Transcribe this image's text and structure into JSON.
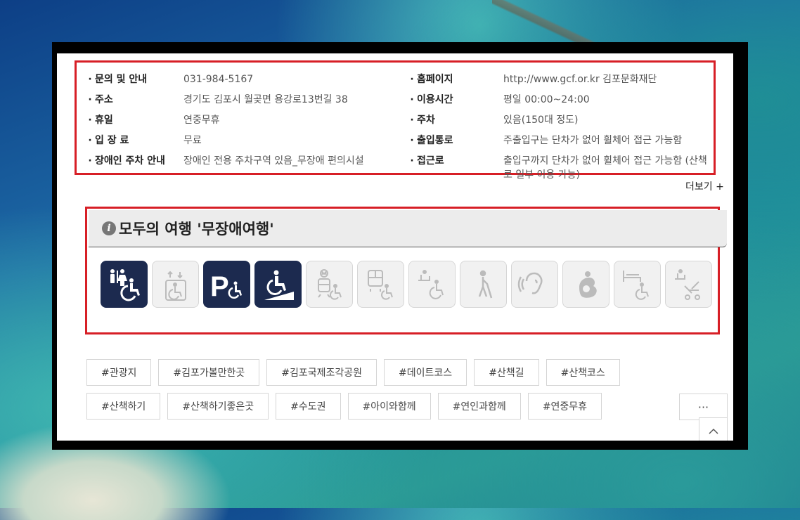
{
  "info": {
    "left": [
      {
        "label": "문의 및 안내",
        "value": "031-984-5167"
      },
      {
        "label": "주소",
        "value": "경기도 김포시 월곶면 용강로13번길 38"
      },
      {
        "label": "휴일",
        "value": "연중무휴"
      },
      {
        "label": "입 장 료",
        "value": "무료"
      },
      {
        "label": "장애인 주차 안내",
        "value": "장애인 전용 주차구역 있음_무장애 편의시설"
      }
    ],
    "right": [
      {
        "label": "홈페이지",
        "value": "http://www.gcf.or.kr 김포문화재단"
      },
      {
        "label": "이용시간",
        "value": "평일 00:00~24:00"
      },
      {
        "label": "주차",
        "value": "있음(150대 정도)"
      },
      {
        "label": "출입통로",
        "value": "주출입구는 단차가 없어 휠체어 접근 가능함"
      },
      {
        "label": "접근로",
        "value": "출입구까지 단차가 없어 휠체어 접근 가능함 (산책로 일부 이용 가능)"
      }
    ],
    "bullet": "·"
  },
  "more": {
    "label": "더보기  +"
  },
  "accessibility": {
    "title": "모두의 여행 '무장애여행'",
    "info_icon": "i",
    "icons": [
      {
        "name": "accessible-restroom-icon",
        "active": true
      },
      {
        "name": "elevator-icon",
        "active": false
      },
      {
        "name": "accessible-parking-icon",
        "active": true
      },
      {
        "name": "wheelchair-ramp-icon",
        "active": true
      },
      {
        "name": "subway-access-icon",
        "active": false
      },
      {
        "name": "bus-access-icon",
        "active": false
      },
      {
        "name": "wheelchair-rental-icon",
        "active": false
      },
      {
        "name": "visually-impaired-icon",
        "active": false
      },
      {
        "name": "hearing-impaired-icon",
        "active": false
      },
      {
        "name": "nursing-room-icon",
        "active": false
      },
      {
        "name": "accessible-room-icon",
        "active": false
      },
      {
        "name": "stroller-rental-icon",
        "active": false
      }
    ],
    "colors": {
      "active": "#1c2a4f",
      "inactive": "#f1f1f1",
      "highlight_border": "#d71f26"
    }
  },
  "tags": {
    "row1": [
      "#관광지",
      "#김포가볼만한곳",
      "#김포국제조각공원",
      "#데이트코스",
      "#산책길",
      "#산책코스"
    ],
    "row2": [
      "#산책하기",
      "#산책하기좋은곳",
      "#수도권",
      "#아이와함께",
      "#연인과함께",
      "#연중무휴"
    ],
    "more_label": "···"
  },
  "top_button": {
    "icon": "chevron-up-icon"
  }
}
